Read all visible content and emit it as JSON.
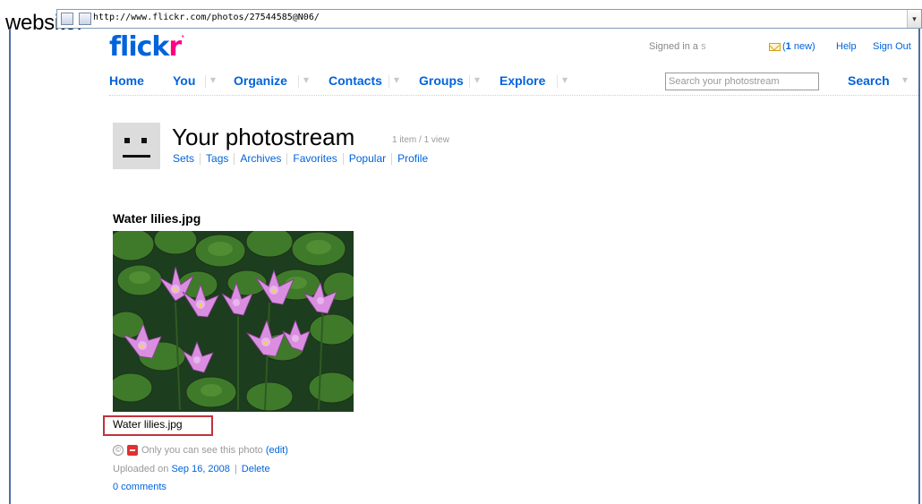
{
  "overlay_label": "website:",
  "browser": {
    "url": "http://www.flickr.com/photos/27544585@N06/",
    "dropdown_glyph": "▾"
  },
  "header": {
    "logo_main": "flick",
    "logo_accent": "r",
    "logo_tm": "•",
    "signed_in": "Signed in a",
    "signed_in_user": "s",
    "mail_count": "1",
    "mail_suffix": " new)",
    "mail_open": "(",
    "help": "Help",
    "sign_out": "Sign Out"
  },
  "nav": {
    "items": [
      "Home",
      "You",
      "Organize",
      "Contacts",
      "Groups",
      "Explore"
    ],
    "arrow": "▾"
  },
  "search": {
    "placeholder": "Search your photostream",
    "button": "Search"
  },
  "photostream": {
    "title": "Your photostream",
    "count": "1 item / 1 view",
    "subnav": [
      "Sets",
      "Tags",
      "Archives",
      "Favorites",
      "Popular",
      "Profile"
    ]
  },
  "photo": {
    "heading": "Water lilies.jpg",
    "title": "Water lilies.jpg",
    "privacy_text": "Only you can see this photo",
    "edit_link": "(edit)",
    "uploaded_prefix": "Uploaded on",
    "uploaded_date": "Sep 16, 2008",
    "delete": "Delete",
    "comments": "0 comments",
    "license_glyph": "©"
  },
  "colors": {
    "link_blue": "#0063dc",
    "flickr_pink": "#ff0084",
    "highlight_red": "#c0333a"
  }
}
